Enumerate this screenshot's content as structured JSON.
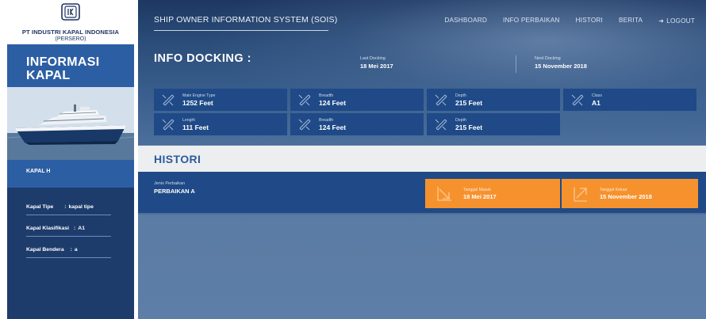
{
  "brand": {
    "name": "PT INDUSTRI KAPAL INDONESIA",
    "sub": "(PERSERO)"
  },
  "sidebar": {
    "title": "INFORMASI KAPAL",
    "ship_name": "KAPAL H",
    "details": [
      {
        "label": "Kapal Tipe",
        "value": "kapal tipe"
      },
      {
        "label": "Kapal Klasifikasi",
        "value": "A1"
      },
      {
        "label": "Kapal Bendera",
        "value": "a"
      }
    ]
  },
  "header": {
    "system_title": "SHIP OWNER INFORMATION SYSTEM (SOIS)",
    "nav": [
      "DASHBOARD",
      "INFO PERBAIKAN",
      "HISTORI",
      "BERITA",
      "LOGOUT"
    ]
  },
  "docking": {
    "title": "INFO DOCKING :",
    "last_label": "Last Docking",
    "last_value": "18 Mei 2017",
    "next_label": "Next Docking",
    "next_value": "15 November 2018"
  },
  "specs": [
    {
      "label": "Main Engine Type",
      "value": "1252 Feet"
    },
    {
      "label": "Breadth",
      "value": "124 Feet"
    },
    {
      "label": "Depth",
      "value": "215 Feet"
    },
    {
      "label": "Class",
      "value": "A1"
    },
    {
      "label": "Lenght",
      "value": "111 Feet"
    },
    {
      "label": "Breadth",
      "value": "124 Feet"
    },
    {
      "label": "Depth",
      "value": "215 Feet"
    }
  ],
  "histori": {
    "title": "HISTORI",
    "type_label": "Jenis Perbaikan",
    "type_value": "PERBAIKAN A",
    "in_label": "Tanggal Masuk",
    "in_value": "18 Mei 2017",
    "out_label": "Tanggal Keluar",
    "out_value": "15 November 2018"
  },
  "icons": {
    "spec": "ruler-pencil-icon",
    "in": "arrow-down-right-icon",
    "out": "arrow-up-right-icon",
    "logout": "logout-icon"
  },
  "colors": {
    "primary": "#2c5ea3",
    "dark": "#1d3c6c",
    "card": "#1f4a87",
    "accent": "#f6922e"
  }
}
